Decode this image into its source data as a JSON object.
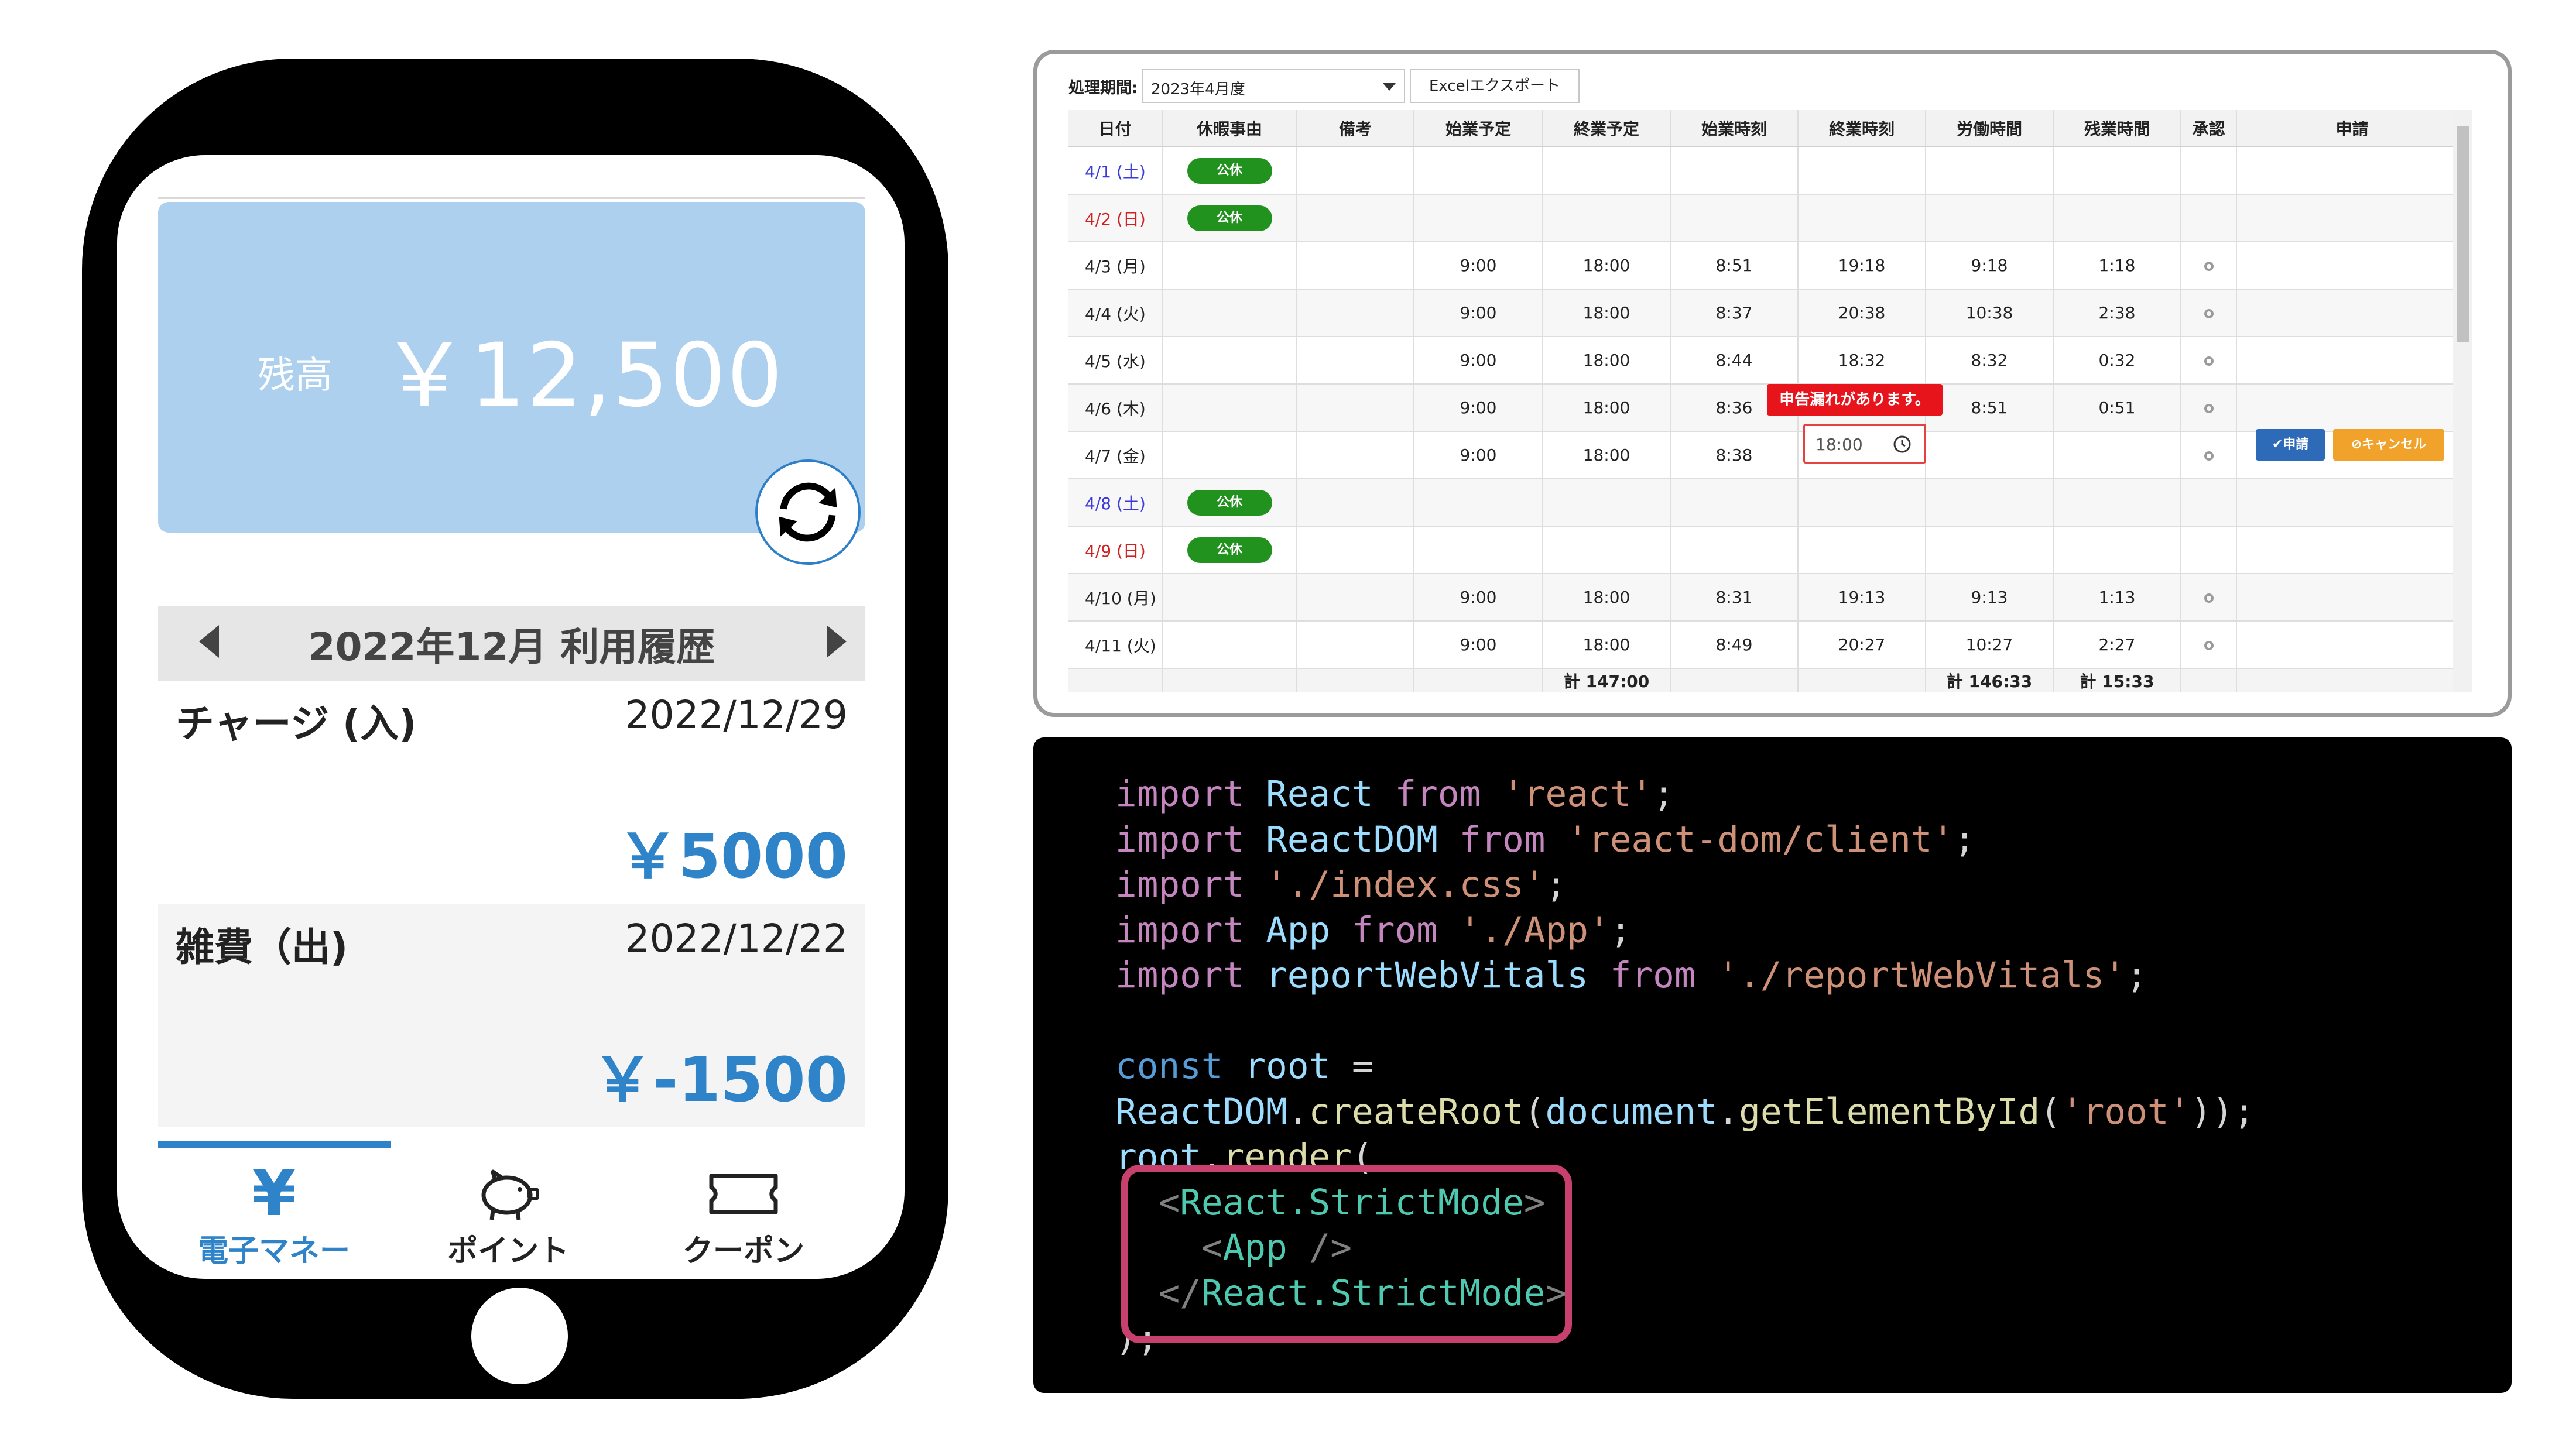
{
  "phone": {
    "balance_label": "残高",
    "balance_value": "￥12,500",
    "month_title": "2022年12月 利用履歴",
    "transactions": [
      {
        "label": "チャージ (入)",
        "date": "2022/12/29",
        "amount": "￥5000"
      },
      {
        "label": "雑費（出)",
        "date": "2022/12/22",
        "amount": "￥-1500"
      }
    ],
    "tabs": [
      {
        "label": "電子マネー",
        "icon": "yen-icon",
        "active": true
      },
      {
        "label": "ポイント",
        "icon": "piggy-bank-icon",
        "active": false
      },
      {
        "label": "クーポン",
        "icon": "ticket-icon",
        "active": false
      }
    ],
    "colors": {
      "card": "#acd0ee",
      "accent": "#2f84c9"
    }
  },
  "attendance": {
    "period_label": "処理期間:",
    "period_value": "2023年4月度",
    "export_label": "Excelエクスポート",
    "columns": [
      "日付",
      "休暇事由",
      "備考",
      "始業予定",
      "終業予定",
      "始業時刻",
      "終業時刻",
      "労働時間",
      "残業時間",
      "承認",
      "申請"
    ],
    "rows": [
      {
        "date": "4/1 (土)",
        "day_type": "sat",
        "reason": "公休",
        "note": "",
        "start_plan": "",
        "end_plan": "",
        "start": "",
        "end": "",
        "work": "",
        "overtime": "",
        "approval": false
      },
      {
        "date": "4/2 (日)",
        "day_type": "sun",
        "reason": "公休",
        "note": "",
        "start_plan": "",
        "end_plan": "",
        "start": "",
        "end": "",
        "work": "",
        "overtime": "",
        "approval": false
      },
      {
        "date": "4/3 (月)",
        "day_type": "weekday",
        "reason": "",
        "note": "",
        "start_plan": "9:00",
        "end_plan": "18:00",
        "start": "8:51",
        "end": "19:18",
        "work": "9:18",
        "overtime": "1:18",
        "approval": true
      },
      {
        "date": "4/4 (火)",
        "day_type": "weekday",
        "reason": "",
        "note": "",
        "start_plan": "9:00",
        "end_plan": "18:00",
        "start": "8:37",
        "end": "20:38",
        "work": "10:38",
        "overtime": "2:38",
        "approval": true
      },
      {
        "date": "4/5 (水)",
        "day_type": "weekday",
        "reason": "",
        "note": "",
        "start_plan": "9:00",
        "end_plan": "18:00",
        "start": "8:44",
        "end": "18:32",
        "work": "8:32",
        "overtime": "0:32",
        "approval": true
      },
      {
        "date": "4/6 (木)",
        "day_type": "weekday",
        "reason": "",
        "note": "",
        "start_plan": "9:00",
        "end_plan": "18:00",
        "start": "8:36",
        "end": "",
        "work": "8:51",
        "overtime": "0:51",
        "approval": true
      },
      {
        "date": "4/7 (金)",
        "day_type": "weekday",
        "reason": "",
        "note": "",
        "start_plan": "9:00",
        "end_plan": "18:00",
        "start": "8:38",
        "end": "",
        "work": "",
        "overtime": "",
        "approval": true
      },
      {
        "date": "4/8 (土)",
        "day_type": "sat",
        "reason": "公休",
        "note": "",
        "start_plan": "",
        "end_plan": "",
        "start": "",
        "end": "",
        "work": "",
        "overtime": "",
        "approval": false
      },
      {
        "date": "4/9 (日)",
        "day_type": "sun",
        "reason": "公休",
        "note": "",
        "start_plan": "",
        "end_plan": "",
        "start": "",
        "end": "",
        "work": "",
        "overtime": "",
        "approval": false
      },
      {
        "date": "4/10 (月)",
        "day_type": "weekday",
        "reason": "",
        "note": "",
        "start_plan": "9:00",
        "end_plan": "18:00",
        "start": "8:31",
        "end": "19:13",
        "work": "9:13",
        "overtime": "1:13",
        "approval": true
      },
      {
        "date": "4/11 (火)",
        "day_type": "weekday",
        "reason": "",
        "note": "",
        "start_plan": "9:00",
        "end_plan": "18:00",
        "start": "8:49",
        "end": "20:27",
        "work": "10:27",
        "overtime": "2:27",
        "approval": true
      }
    ],
    "totals": {
      "end_plan": "計 147:00",
      "work": "計 146:33",
      "overtime": "計 15:33"
    },
    "warning": "申告漏れがあります。",
    "edit_time_value": "18:00",
    "apply_label": "✔申請",
    "cancel_label": "⊘キャンセル",
    "colors": {
      "holiday_badge": "#21921e",
      "warning": "#e8141c",
      "apply": "#2d6bb8",
      "cancel": "#f0a22b",
      "saturday": "#3a3ad8",
      "sunday": "#d02020"
    }
  },
  "code": {
    "lines": [
      [
        {
          "t": "import",
          "c": "kw"
        },
        {
          "t": " React ",
          "c": "id"
        },
        {
          "t": "from",
          "c": "kw"
        },
        {
          "t": " 'react'",
          "c": "str"
        },
        {
          "t": ";",
          "c": "def"
        }
      ],
      [
        {
          "t": "import",
          "c": "kw"
        },
        {
          "t": " ReactDOM ",
          "c": "id"
        },
        {
          "t": "from",
          "c": "kw"
        },
        {
          "t": " 'react-dom/client'",
          "c": "str"
        },
        {
          "t": ";",
          "c": "def"
        }
      ],
      [
        {
          "t": "import",
          "c": "kw"
        },
        {
          "t": " './index.css'",
          "c": "str"
        },
        {
          "t": ";",
          "c": "def"
        }
      ],
      [
        {
          "t": "import",
          "c": "kw"
        },
        {
          "t": " App ",
          "c": "id"
        },
        {
          "t": "from",
          "c": "kw"
        },
        {
          "t": " './App'",
          "c": "str"
        },
        {
          "t": ";",
          "c": "def"
        }
      ],
      [
        {
          "t": "import",
          "c": "kw"
        },
        {
          "t": " reportWebVitals ",
          "c": "id"
        },
        {
          "t": "from",
          "c": "kw"
        },
        {
          "t": " './reportWebVitals'",
          "c": "str"
        },
        {
          "t": ";",
          "c": "def"
        }
      ],
      [],
      [
        {
          "t": "const",
          "c": "decl"
        },
        {
          "t": " root",
          "c": "id"
        },
        {
          "t": " =",
          "c": "def"
        }
      ],
      [
        {
          "t": "ReactDOM",
          "c": "id"
        },
        {
          "t": ".",
          "c": "def"
        },
        {
          "t": "createRoot",
          "c": "fn"
        },
        {
          "t": "(",
          "c": "def"
        },
        {
          "t": "document",
          "c": "id"
        },
        {
          "t": ".",
          "c": "def"
        },
        {
          "t": "getElementById",
          "c": "fn"
        },
        {
          "t": "(",
          "c": "def"
        },
        {
          "t": "'root'",
          "c": "str"
        },
        {
          "t": "));",
          "c": "def"
        }
      ],
      [
        {
          "t": "root",
          "c": "id"
        },
        {
          "t": ".",
          "c": "def"
        },
        {
          "t": "render",
          "c": "fn"
        },
        {
          "t": "(",
          "c": "def"
        }
      ],
      [
        {
          "t": "  <",
          "c": "punc"
        },
        {
          "t": "React.StrictMode",
          "c": "tag"
        },
        {
          "t": ">",
          "c": "punc"
        }
      ],
      [
        {
          "t": "    <",
          "c": "punc"
        },
        {
          "t": "App",
          "c": "tag"
        },
        {
          "t": " />",
          "c": "punc"
        }
      ],
      [
        {
          "t": "  </",
          "c": "punc"
        },
        {
          "t": "React.StrictMode",
          "c": "tag"
        },
        {
          "t": ">",
          "c": "punc"
        }
      ],
      [
        {
          "t": ");",
          "c": "def"
        }
      ]
    ],
    "highlight_color": "#c8416e"
  }
}
